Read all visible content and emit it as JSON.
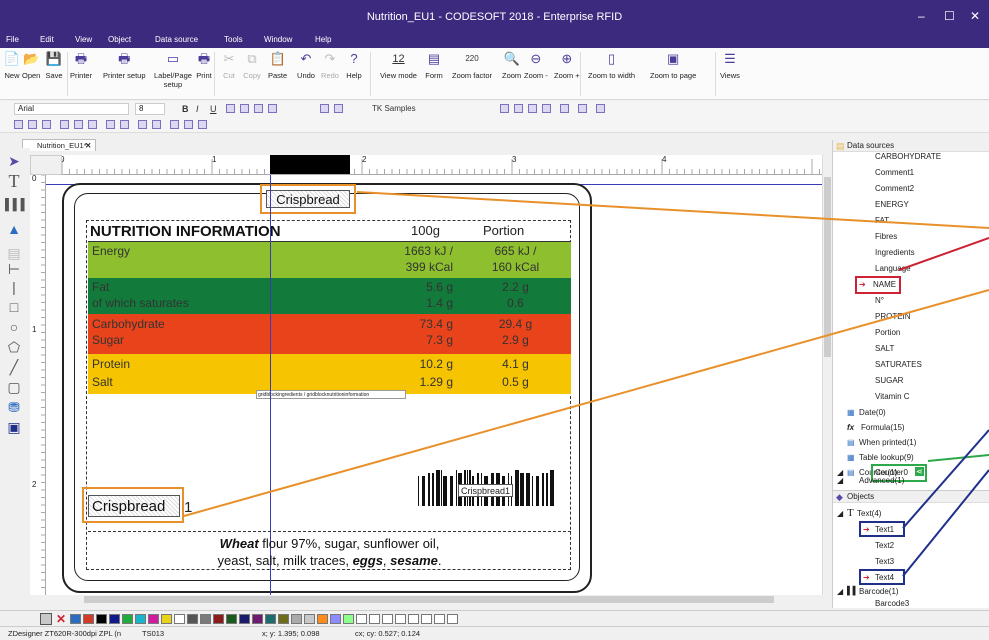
{
  "window": {
    "title": "Nutrition_EU1 - CODESOFT 2018 - Enterprise RFID",
    "btn_min": "–",
    "btn_max": "☐",
    "btn_close": "✕"
  },
  "menu": [
    "File",
    "Edit",
    "View",
    "Object",
    "Data source",
    "Tools",
    "Window",
    "Help"
  ],
  "ribbon": {
    "new": "New",
    "open": "Open",
    "save": "Save",
    "printer": "Printer",
    "printer_setup": "Printer setup",
    "label_page_setup_1": "Label/Page",
    "label_page_setup_2": "setup",
    "print": "Print",
    "cut": "Cut",
    "copy": "Copy",
    "paste": "Paste",
    "undo": "Undo",
    "redo": "Redo",
    "help": "Help",
    "view_mode": "View mode",
    "view_mode_value": "12",
    "form": "Form",
    "zoom_factor": "Zoom factor",
    "zoom_value": "220",
    "zoom": "Zoom",
    "zoom_minus": "Zoom -",
    "zoom_plus": "Zoom +",
    "zoom_width": "Zoom to width",
    "zoom_page": "Zoom to page",
    "views": "Views"
  },
  "format": {
    "font": "Arial",
    "size": "8",
    "bold": "B",
    "italic": "I",
    "underline": "U",
    "samples": "TK Samples"
  },
  "doc_tab": {
    "name": "Nutrition_EU1*",
    "close": "✕"
  },
  "ruler": {
    "h": [
      "0",
      "1",
      "2",
      "3",
      "4"
    ],
    "v": [
      "0",
      "1",
      "2"
    ]
  },
  "label": {
    "crisp_top": "Crispbread",
    "heading": "NUTRITION INFORMATION",
    "col_100g": "100g",
    "col_portion": "Portion",
    "rows": [
      {
        "name": "Energy",
        "v1a": "1663 kJ /",
        "v1b": "399 kCal",
        "v2a": "665 kJ /",
        "v2b": "160 kCal",
        "color": "#8dbf2f"
      },
      {
        "name": "Fat",
        "name2": "of which saturates",
        "v1a": "5.6 g",
        "v1b": "1.4 g",
        "v2a": "2.2 g",
        "v2b": "0.6",
        "color": "#127a3a"
      },
      {
        "name": "Carbohydrate",
        "name2": "Sugar",
        "v1a": "73.4 g",
        "v1b": "7.3 g",
        "v2a": "29.4 g",
        "v2b": "2.9 g",
        "color": "#e8431b"
      },
      {
        "name": "Protein",
        "name2": "Salt",
        "v1a": "10.2 g",
        "v1b": "1.29 g",
        "v2a": "4.1 g",
        "v2b": "0.5 g",
        "color": "#f6c400"
      }
    ],
    "grid_tag": "gridblockingredients / gridblocknutritioninformation",
    "crisp_bottom": "Crispbread",
    "counter_val": "1",
    "barcode_text": "Crispbread1",
    "ing_wheat": "Wheat",
    "ing_line1": " flour 97%, sugar, sunflower oil,",
    "ing_line2a": "yeast, salt, milk traces, ",
    "ing_eggs": "eggs",
    ", ": ", ",
    "ing_sesame": "sesame",
    "ing_dot": "."
  },
  "data_sources": {
    "title": "Data sources",
    "vars": [
      "CARBOHYDRATE",
      "Comment1",
      "Comment2",
      "ENERGY",
      "FAT",
      "Fibres",
      "Ingredients",
      "Language",
      "NAME",
      "N°",
      "PROTEIN",
      "Portion",
      "SALT",
      "SATURATES",
      "SUGAR",
      "Vitamin C"
    ],
    "groups": [
      "Date(0)",
      "Formula(15)",
      "When printed(1)",
      "Table lookup(9)",
      "Counter(1)",
      "Counter0",
      "Advanced(1)"
    ]
  },
  "objects": {
    "title": "Objects",
    "items": [
      "Text(4)",
      "Text1",
      "Text2",
      "Text3",
      "Text4",
      "Barcode(1)",
      "Barcode3"
    ]
  },
  "status": {
    "printer": "ZDesigner ZT620R-300dpi ZPL (n",
    "port": "TS013",
    "xy": "x; y: 1.395; 0.098",
    "cxcy": "cx; cy: 0.527; 0.124"
  },
  "colors": {
    "title_bg": "#3b2a7e",
    "orange": "#e8902a",
    "red": "#cc2233",
    "blue": "#1f2f8a",
    "green": "#2da84a"
  },
  "palette": [
    "#2a6cc0",
    "#d23a2a",
    "#000000",
    "#111a8c",
    "#1faa3a",
    "#1ab4c8",
    "#d21aa0",
    "#e8d21a",
    "#ffffff",
    "#555555",
    "#7a7a7a",
    "#8c1a1a",
    "#1a5a1a",
    "#1a1a6e",
    "#6e1a6e",
    "#1a6e6e",
    "#6e6e1a",
    "#aaaaaa",
    "#c8c8c8",
    "#ff8c1a",
    "#8c8cff",
    "#8cff8c",
    "#ffffff",
    "#ffffff",
    "#ffffff",
    "#ffffff",
    "#ffffff",
    "#ffffff",
    "#ffffff",
    "#ffffff"
  ]
}
